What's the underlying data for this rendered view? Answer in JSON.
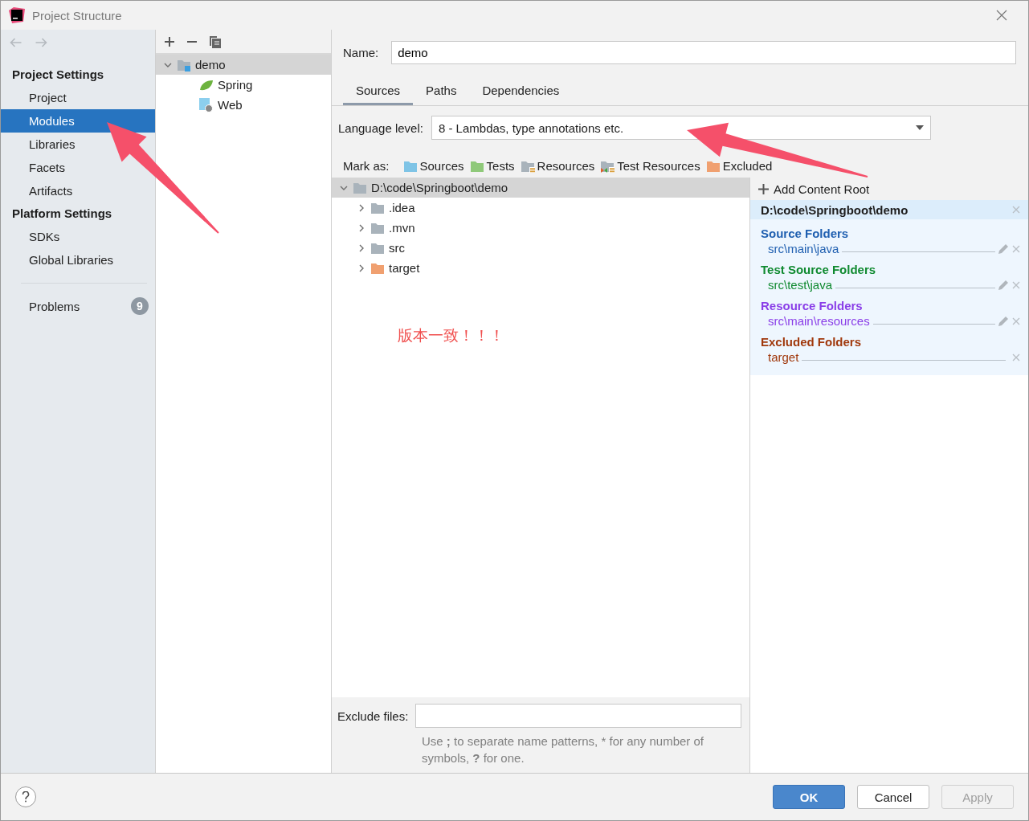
{
  "window": {
    "title": "Project Structure"
  },
  "sidebar": {
    "sections": [
      {
        "title": "Project Settings",
        "items": [
          {
            "label": "Project",
            "selected": false
          },
          {
            "label": "Modules",
            "selected": true
          },
          {
            "label": "Libraries",
            "selected": false
          },
          {
            "label": "Facets",
            "selected": false
          },
          {
            "label": "Artifacts",
            "selected": false
          }
        ]
      },
      {
        "title": "Platform Settings",
        "items": [
          {
            "label": "SDKs",
            "selected": false
          },
          {
            "label": "Global Libraries",
            "selected": false
          }
        ]
      }
    ],
    "problems": {
      "label": "Problems",
      "count": "9"
    }
  },
  "modules": [
    {
      "label": "demo",
      "kind": "module",
      "expanded": true,
      "selected": true,
      "children": [
        {
          "label": "Spring",
          "kind": "spring"
        },
        {
          "label": "Web",
          "kind": "web"
        }
      ]
    }
  ],
  "name_field": {
    "label": "Name:",
    "value": "demo"
  },
  "tabs": [
    {
      "label": "Sources",
      "selected": true
    },
    {
      "label": "Paths",
      "selected": false
    },
    {
      "label": "Dependencies",
      "selected": false
    }
  ],
  "language_level": {
    "label": "Language level:",
    "value": "8 - Lambdas, type annotations etc."
  },
  "mark_as": {
    "label": "Mark as:",
    "options": [
      {
        "label": "Sources",
        "kind": "sources"
      },
      {
        "label": "Tests",
        "kind": "tests"
      },
      {
        "label": "Resources",
        "kind": "resources"
      },
      {
        "label": "Test Resources",
        "kind": "test-resources"
      },
      {
        "label": "Excluded",
        "kind": "excluded"
      }
    ]
  },
  "content_tree": [
    {
      "label": "D:\\code\\Springboot\\demo",
      "kind": "folder",
      "expanded": true,
      "selected": true,
      "children": [
        {
          "label": ".idea",
          "kind": "folder",
          "expanded": false
        },
        {
          "label": ".mvn",
          "kind": "folder",
          "expanded": false
        },
        {
          "label": "src",
          "kind": "folder",
          "expanded": false
        },
        {
          "label": "target",
          "kind": "excluded",
          "expanded": false
        }
      ]
    }
  ],
  "annotation": "版本一致！！！",
  "content_roots": {
    "add_label": "Add Content Root",
    "root": "D:\\code\\Springboot\\demo",
    "groups": [
      {
        "title": "Source Folders",
        "color": "#1f5fb0",
        "folders": [
          {
            "path": "src\\main\\java",
            "editable": true
          }
        ]
      },
      {
        "title": "Test Source Folders",
        "color": "#108a30",
        "folders": [
          {
            "path": "src\\test\\java",
            "editable": true
          }
        ]
      },
      {
        "title": "Resource Folders",
        "color": "#8a3ee8",
        "folders": [
          {
            "path": "src\\main\\resources",
            "editable": true
          }
        ]
      },
      {
        "title": "Excluded Folders",
        "color": "#a0380c",
        "folders": [
          {
            "path": "target",
            "editable": false
          }
        ]
      }
    ]
  },
  "exclude_files": {
    "label": "Exclude files:",
    "hint": "Use **;** to separate name patterns, * for any number of symbols, **?** for one."
  },
  "buttons": [
    {
      "label": "OK",
      "kind": "primary",
      "disabled": false
    },
    {
      "label": "Cancel",
      "kind": "normal",
      "disabled": false
    },
    {
      "label": "Apply",
      "kind": "normal",
      "disabled": true
    }
  ]
}
